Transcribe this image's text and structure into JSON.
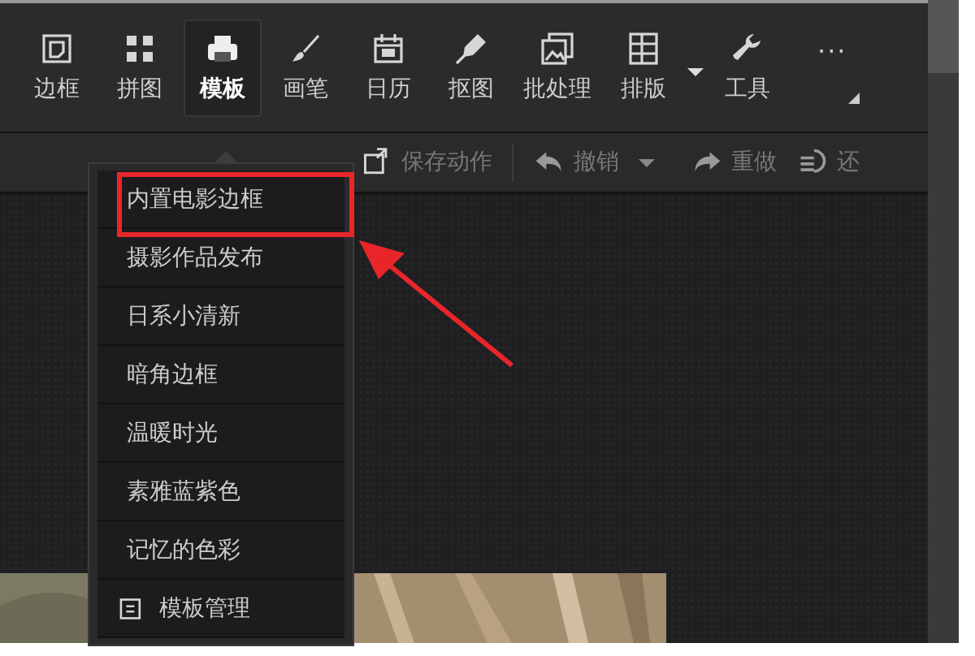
{
  "toolbar": {
    "tools": [
      {
        "label": "边框",
        "selected": false
      },
      {
        "label": "拼图",
        "selected": false
      },
      {
        "label": "模板",
        "selected": true
      },
      {
        "label": "画笔",
        "selected": false
      },
      {
        "label": "日历",
        "selected": false
      },
      {
        "label": "抠图",
        "selected": false
      },
      {
        "label": "批处理",
        "selected": false
      },
      {
        "label": "排版",
        "selected": false
      },
      {
        "label": "工具",
        "selected": false
      }
    ],
    "more": "···"
  },
  "action_bar": {
    "actions": [
      {
        "label": "保存动作"
      },
      {
        "label": "撤销"
      },
      {
        "label": "重做"
      },
      {
        "label": "还"
      }
    ]
  },
  "template_menu": {
    "items": [
      {
        "label": "内置电影边框",
        "kind": "item",
        "highlighted": true
      },
      {
        "label": "摄影作品发布",
        "kind": "item",
        "highlighted": false
      },
      {
        "label": "日系小清新",
        "kind": "item",
        "highlighted": false
      },
      {
        "label": "暗角边框",
        "kind": "item",
        "highlighted": false
      },
      {
        "label": "温暖时光",
        "kind": "item",
        "highlighted": false
      },
      {
        "label": "素雅蓝紫色",
        "kind": "item",
        "highlighted": false
      },
      {
        "label": "记忆的色彩",
        "kind": "item",
        "highlighted": false
      },
      {
        "label": "模板管理",
        "kind": "manage",
        "highlighted": false
      }
    ]
  }
}
